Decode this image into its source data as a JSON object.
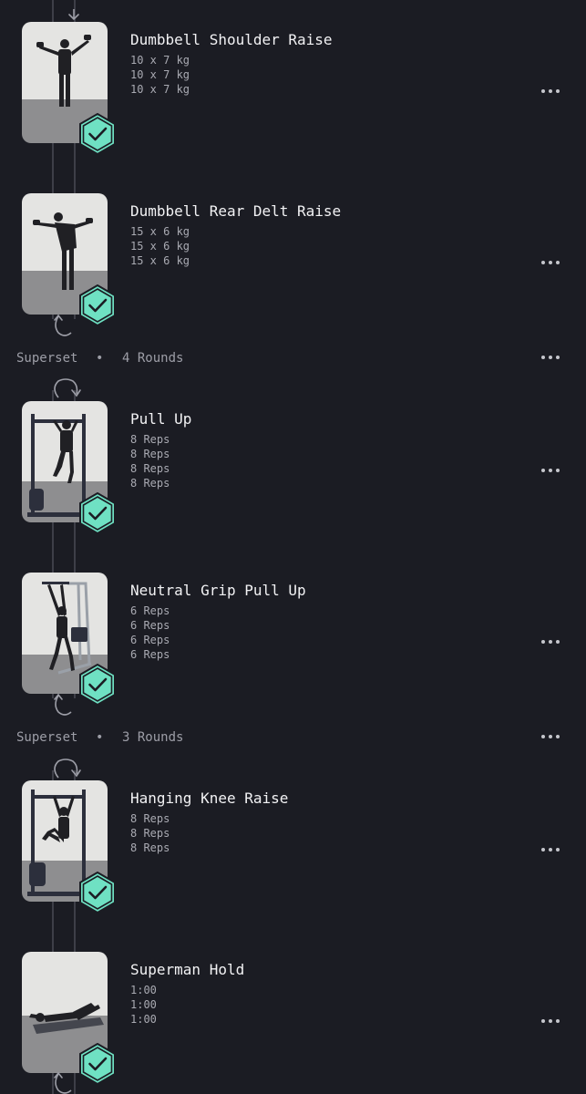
{
  "colors": {
    "background": "#1b1c23",
    "badge_fill": "#6fe1c3",
    "badge_border": "#1b1c23",
    "muted_text": "#a9aab2"
  },
  "supersets": [
    {
      "label": "Superset",
      "separator": "•",
      "rounds": "4 Rounds"
    },
    {
      "label": "Superset",
      "separator": "•",
      "rounds": "3 Rounds"
    }
  ],
  "exercises": [
    {
      "name": "Dumbbell Shoulder Raise",
      "sets": [
        "10 x 7 kg",
        "10 x 7 kg",
        "10 x 7 kg"
      ],
      "completed": true,
      "icon": "check-icon"
    },
    {
      "name": "Dumbbell Rear Delt Raise",
      "sets": [
        "15 x 6 kg",
        "15 x 6 kg",
        "15 x 6 kg"
      ],
      "completed": true,
      "icon": "check-icon"
    },
    {
      "name": "Pull Up",
      "sets": [
        "8 Reps",
        "8 Reps",
        "8 Reps",
        "8 Reps"
      ],
      "completed": true,
      "icon": "check-icon"
    },
    {
      "name": "Neutral Grip Pull Up",
      "sets": [
        "6 Reps",
        "6 Reps",
        "6 Reps",
        "6 Reps"
      ],
      "completed": true,
      "icon": "check-icon"
    },
    {
      "name": "Hanging Knee Raise",
      "sets": [
        "8 Reps",
        "8 Reps",
        "8 Reps"
      ],
      "completed": true,
      "icon": "check-icon"
    },
    {
      "name": "Superman Hold",
      "sets": [
        "1:00",
        "1:00",
        "1:00"
      ],
      "completed": true,
      "icon": "check-icon"
    }
  ]
}
